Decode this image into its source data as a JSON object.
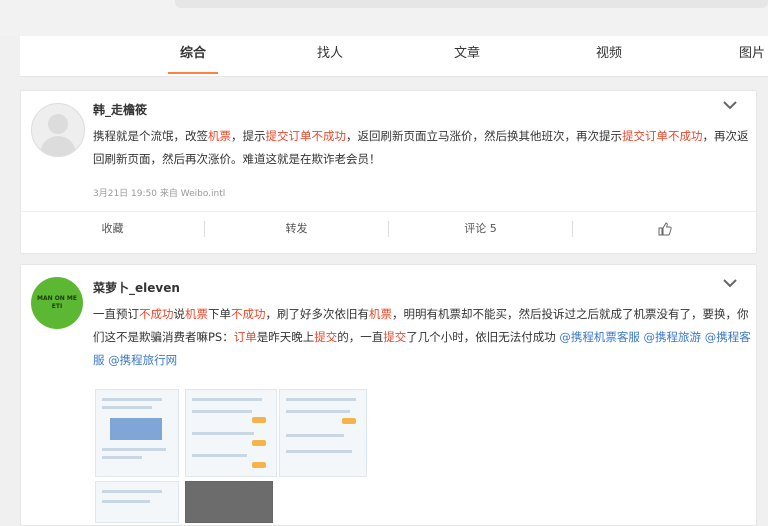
{
  "tabs": [
    {
      "label": "综合",
      "active": true
    },
    {
      "label": "找人",
      "active": false
    },
    {
      "label": "文章",
      "active": false
    },
    {
      "label": "视频",
      "active": false
    },
    {
      "label": "图片",
      "active": false
    }
  ],
  "posts": [
    {
      "user": "韩_走檐筱",
      "segments": [
        {
          "t": "携程就是个流氓，改签"
        },
        {
          "t": "机票",
          "hl": true
        },
        {
          "t": "，提示"
        },
        {
          "t": "提交订单不成功",
          "hl": true
        },
        {
          "t": "，返回刷新页面立马涨价，然后换其他班次，再次提示"
        },
        {
          "t": "提交订单不成功",
          "hl": true
        },
        {
          "t": "，再次返回刷新页面，然后再次涨价。难道这就是在欺诈老会员！"
        }
      ],
      "meta": "3月21日 19:50 来自 Weibo.intl",
      "actions": [
        "收藏",
        "转发",
        "评论 5",
        "赞"
      ]
    },
    {
      "user": "菜萝卜_eleven",
      "avatar_text": "MAN ON ME ETI",
      "segments": [
        {
          "t": "一直预订"
        },
        {
          "t": "不成功",
          "hl": true
        },
        {
          "t": "说"
        },
        {
          "t": "机票",
          "hl": true
        },
        {
          "t": "下单"
        },
        {
          "t": "不成功",
          "hl": true
        },
        {
          "t": "，刷了好多次依旧有"
        },
        {
          "t": "机票",
          "hl": true
        },
        {
          "t": "，明明有机票却不能买，然后投诉过之后就成了机票没有了，要换，你们这不是欺骗消费者嘛PS："
        },
        {
          "t": "订单",
          "hl": true
        },
        {
          "t": "是昨天晚上"
        },
        {
          "t": "提交",
          "hl": true
        },
        {
          "t": "的，一直"
        },
        {
          "t": "提交",
          "hl": true
        },
        {
          "t": "了几个小时，依旧无法付成功 "
        },
        {
          "t": "@携程机票客服",
          "link": true
        },
        {
          "t": " "
        },
        {
          "t": "@携程旅游",
          "link": true
        },
        {
          "t": " "
        },
        {
          "t": "@携程客服",
          "link": true
        },
        {
          "t": " "
        },
        {
          "t": "@携程旅行网",
          "link": true
        }
      ]
    }
  ],
  "icons": {
    "chevron": "chevron-down-icon",
    "like": "thumbs-up-icon"
  }
}
